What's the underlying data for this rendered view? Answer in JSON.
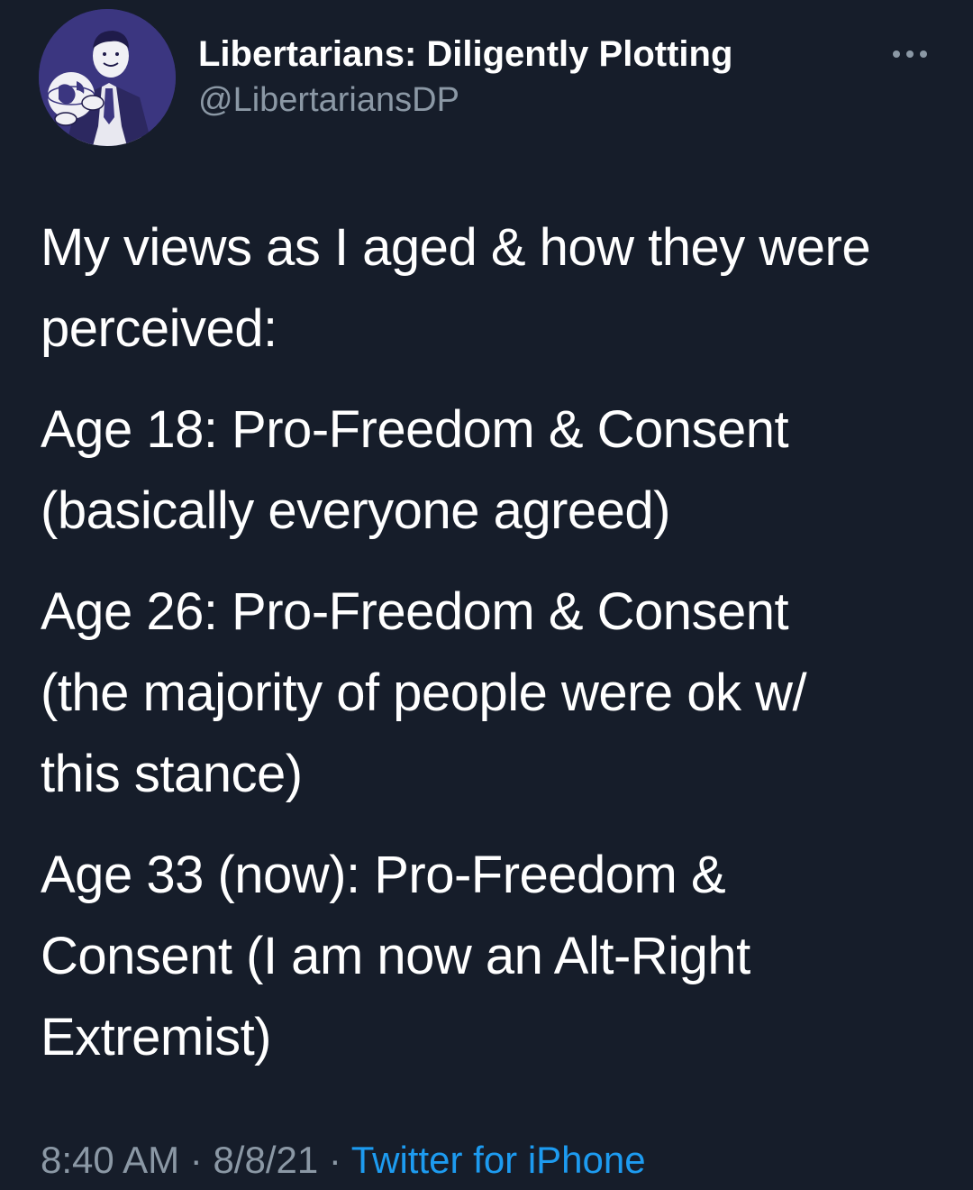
{
  "author": {
    "display_name": "Libertarians: Diligently Plotting",
    "handle": "@LibertariansDP",
    "avatar_icon": "man-holding-globe-illustration"
  },
  "tweet": {
    "paragraphs": [
      {
        "lines": [
          "My views as I aged & how they were",
          "perceived:"
        ]
      },
      {
        "lines": [
          "Age 18: Pro-Freedom & Consent",
          "(basically everyone agreed)"
        ]
      },
      {
        "lines": [
          "Age 26: Pro-Freedom & Consent",
          "(the majority of people were ok w/",
          "this stance)"
        ]
      },
      {
        "lines": [
          "Age 33 (now): Pro-Freedom &",
          "Consent (I am now an Alt-Right",
          "Extremist)"
        ]
      }
    ]
  },
  "meta": {
    "time": "8:40 AM",
    "separator": " · ",
    "date": "8/8/21",
    "source": "Twitter for iPhone"
  },
  "colors": {
    "background": "#161d2a",
    "text": "#ffffff",
    "secondary_text": "#8b98a5",
    "link": "#1d9bf0",
    "avatar_bg": "#3b3680"
  }
}
